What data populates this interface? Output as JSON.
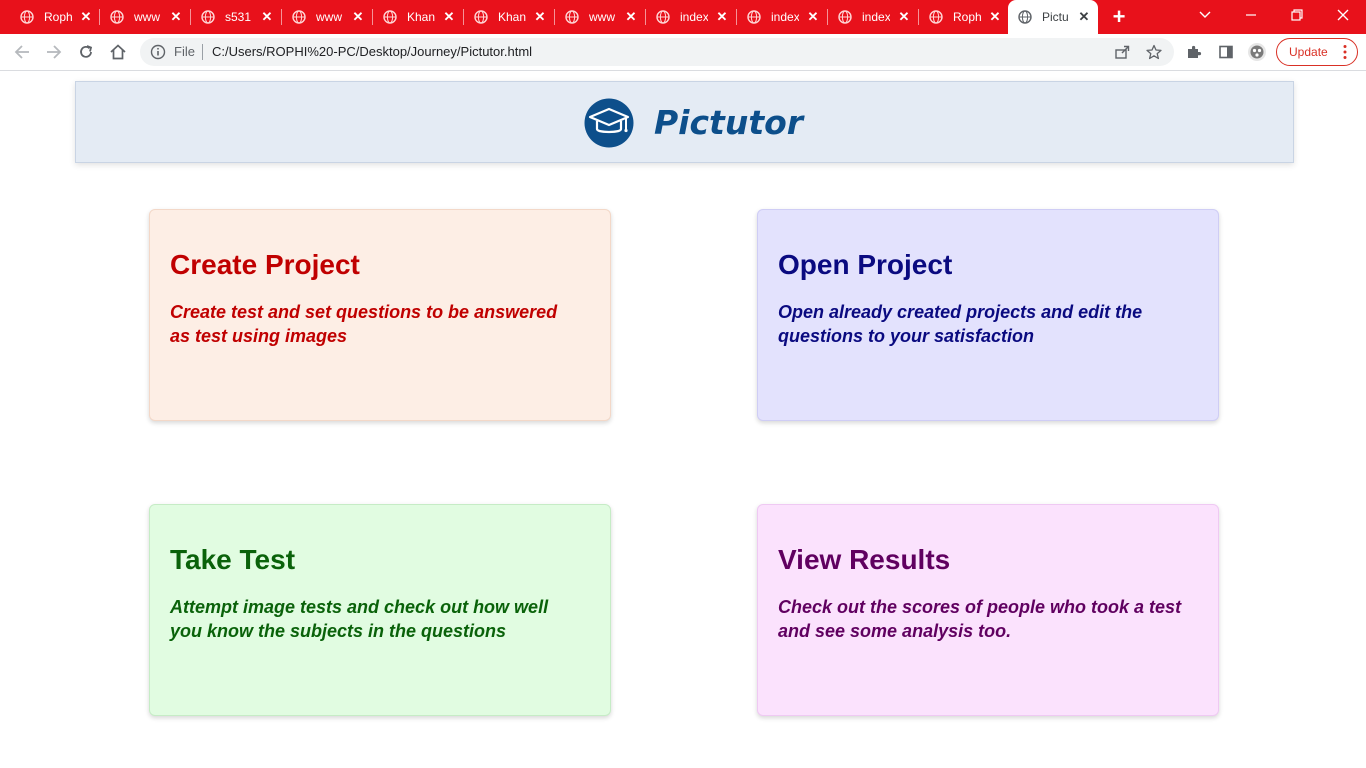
{
  "browser": {
    "tabs": [
      {
        "title": "Roph",
        "active": false
      },
      {
        "title": "www",
        "active": false
      },
      {
        "title": "s531",
        "active": false
      },
      {
        "title": "www",
        "active": false
      },
      {
        "title": "Khan",
        "active": false
      },
      {
        "title": "Khan",
        "active": false
      },
      {
        "title": "www",
        "active": false
      },
      {
        "title": "index",
        "active": false
      },
      {
        "title": "index",
        "active": false
      },
      {
        "title": "index",
        "active": false
      },
      {
        "title": "Roph",
        "active": false
      },
      {
        "title": "Pictu",
        "active": true
      }
    ],
    "omnibox": {
      "scheme_label": "File",
      "url": "C:/Users/ROPHI%20-PC/Desktop/Journey/Pictutor.html"
    },
    "update_label": "Update",
    "colors": {
      "tabstrip": "#e8111b",
      "update": "#d93025"
    }
  },
  "page": {
    "brand": "Pictutor",
    "logo_icon": "graduation-cap-icon",
    "cards": [
      {
        "key": "create",
        "title": "Create Project",
        "desc": "Create test and set questions to be answered as test using images",
        "color": "#c00000",
        "bg": "#fdeee5"
      },
      {
        "key": "open",
        "title": "Open Project",
        "desc": "Open already created projects and edit the questions to your satisfaction",
        "color": "#0a0a80",
        "bg": "#e3e2fd"
      },
      {
        "key": "test",
        "title": "Take Test",
        "desc": "Attempt image tests and check out how well you know the subjects in the questions",
        "color": "#0a620a",
        "bg": "#e1fce1"
      },
      {
        "key": "results",
        "title": "View Results",
        "desc": "Check out the scores of people who took a test and see some analysis too.",
        "color": "#600060",
        "bg": "#fbe2fd"
      }
    ]
  }
}
